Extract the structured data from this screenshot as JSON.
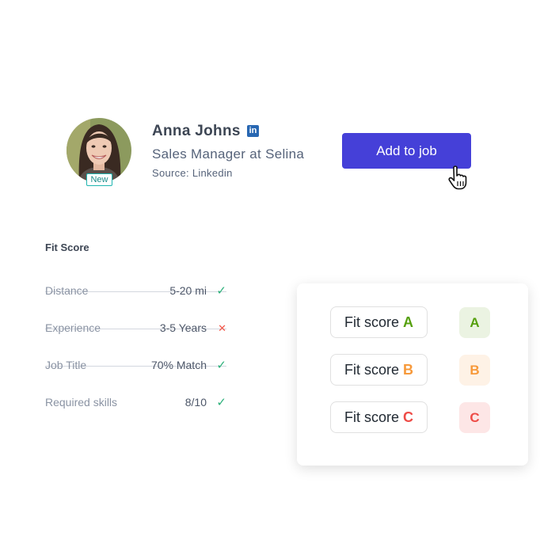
{
  "profile": {
    "name": "Anna Johns",
    "title": "Sales Manager at Selina",
    "source": "Source: Linkedin",
    "badge": "New",
    "linkedin_icon": "in"
  },
  "add_button": {
    "label": "Add to job",
    "color": "#4540d8"
  },
  "fit_score": {
    "title": "Fit Score",
    "rows": [
      {
        "label": "Distance",
        "value": "5-20 mi",
        "status": "check",
        "mark": "✓"
      },
      {
        "label": "Experience",
        "value": "3-5 Years",
        "status": "cross",
        "mark": "✕"
      },
      {
        "label": "Job Title",
        "value": "70% Match",
        "status": "check",
        "mark": "✓"
      },
      {
        "label": "Required skills",
        "value": "8/10",
        "status": "check",
        "mark": "✓"
      }
    ]
  },
  "legend": {
    "items": [
      {
        "prefix": "Fit score",
        "grade": "A",
        "color": "#56a00f",
        "bg": "#ebf3e2"
      },
      {
        "prefix": "Fit score",
        "grade": "B",
        "color": "#f7993a",
        "bg": "#fef2e6"
      },
      {
        "prefix": "Fit score",
        "grade": "C",
        "color": "#ee4c47",
        "bg": "#fde6e6"
      }
    ]
  },
  "colors": {
    "check": "#2bb07a",
    "cross": "#f2584b"
  }
}
